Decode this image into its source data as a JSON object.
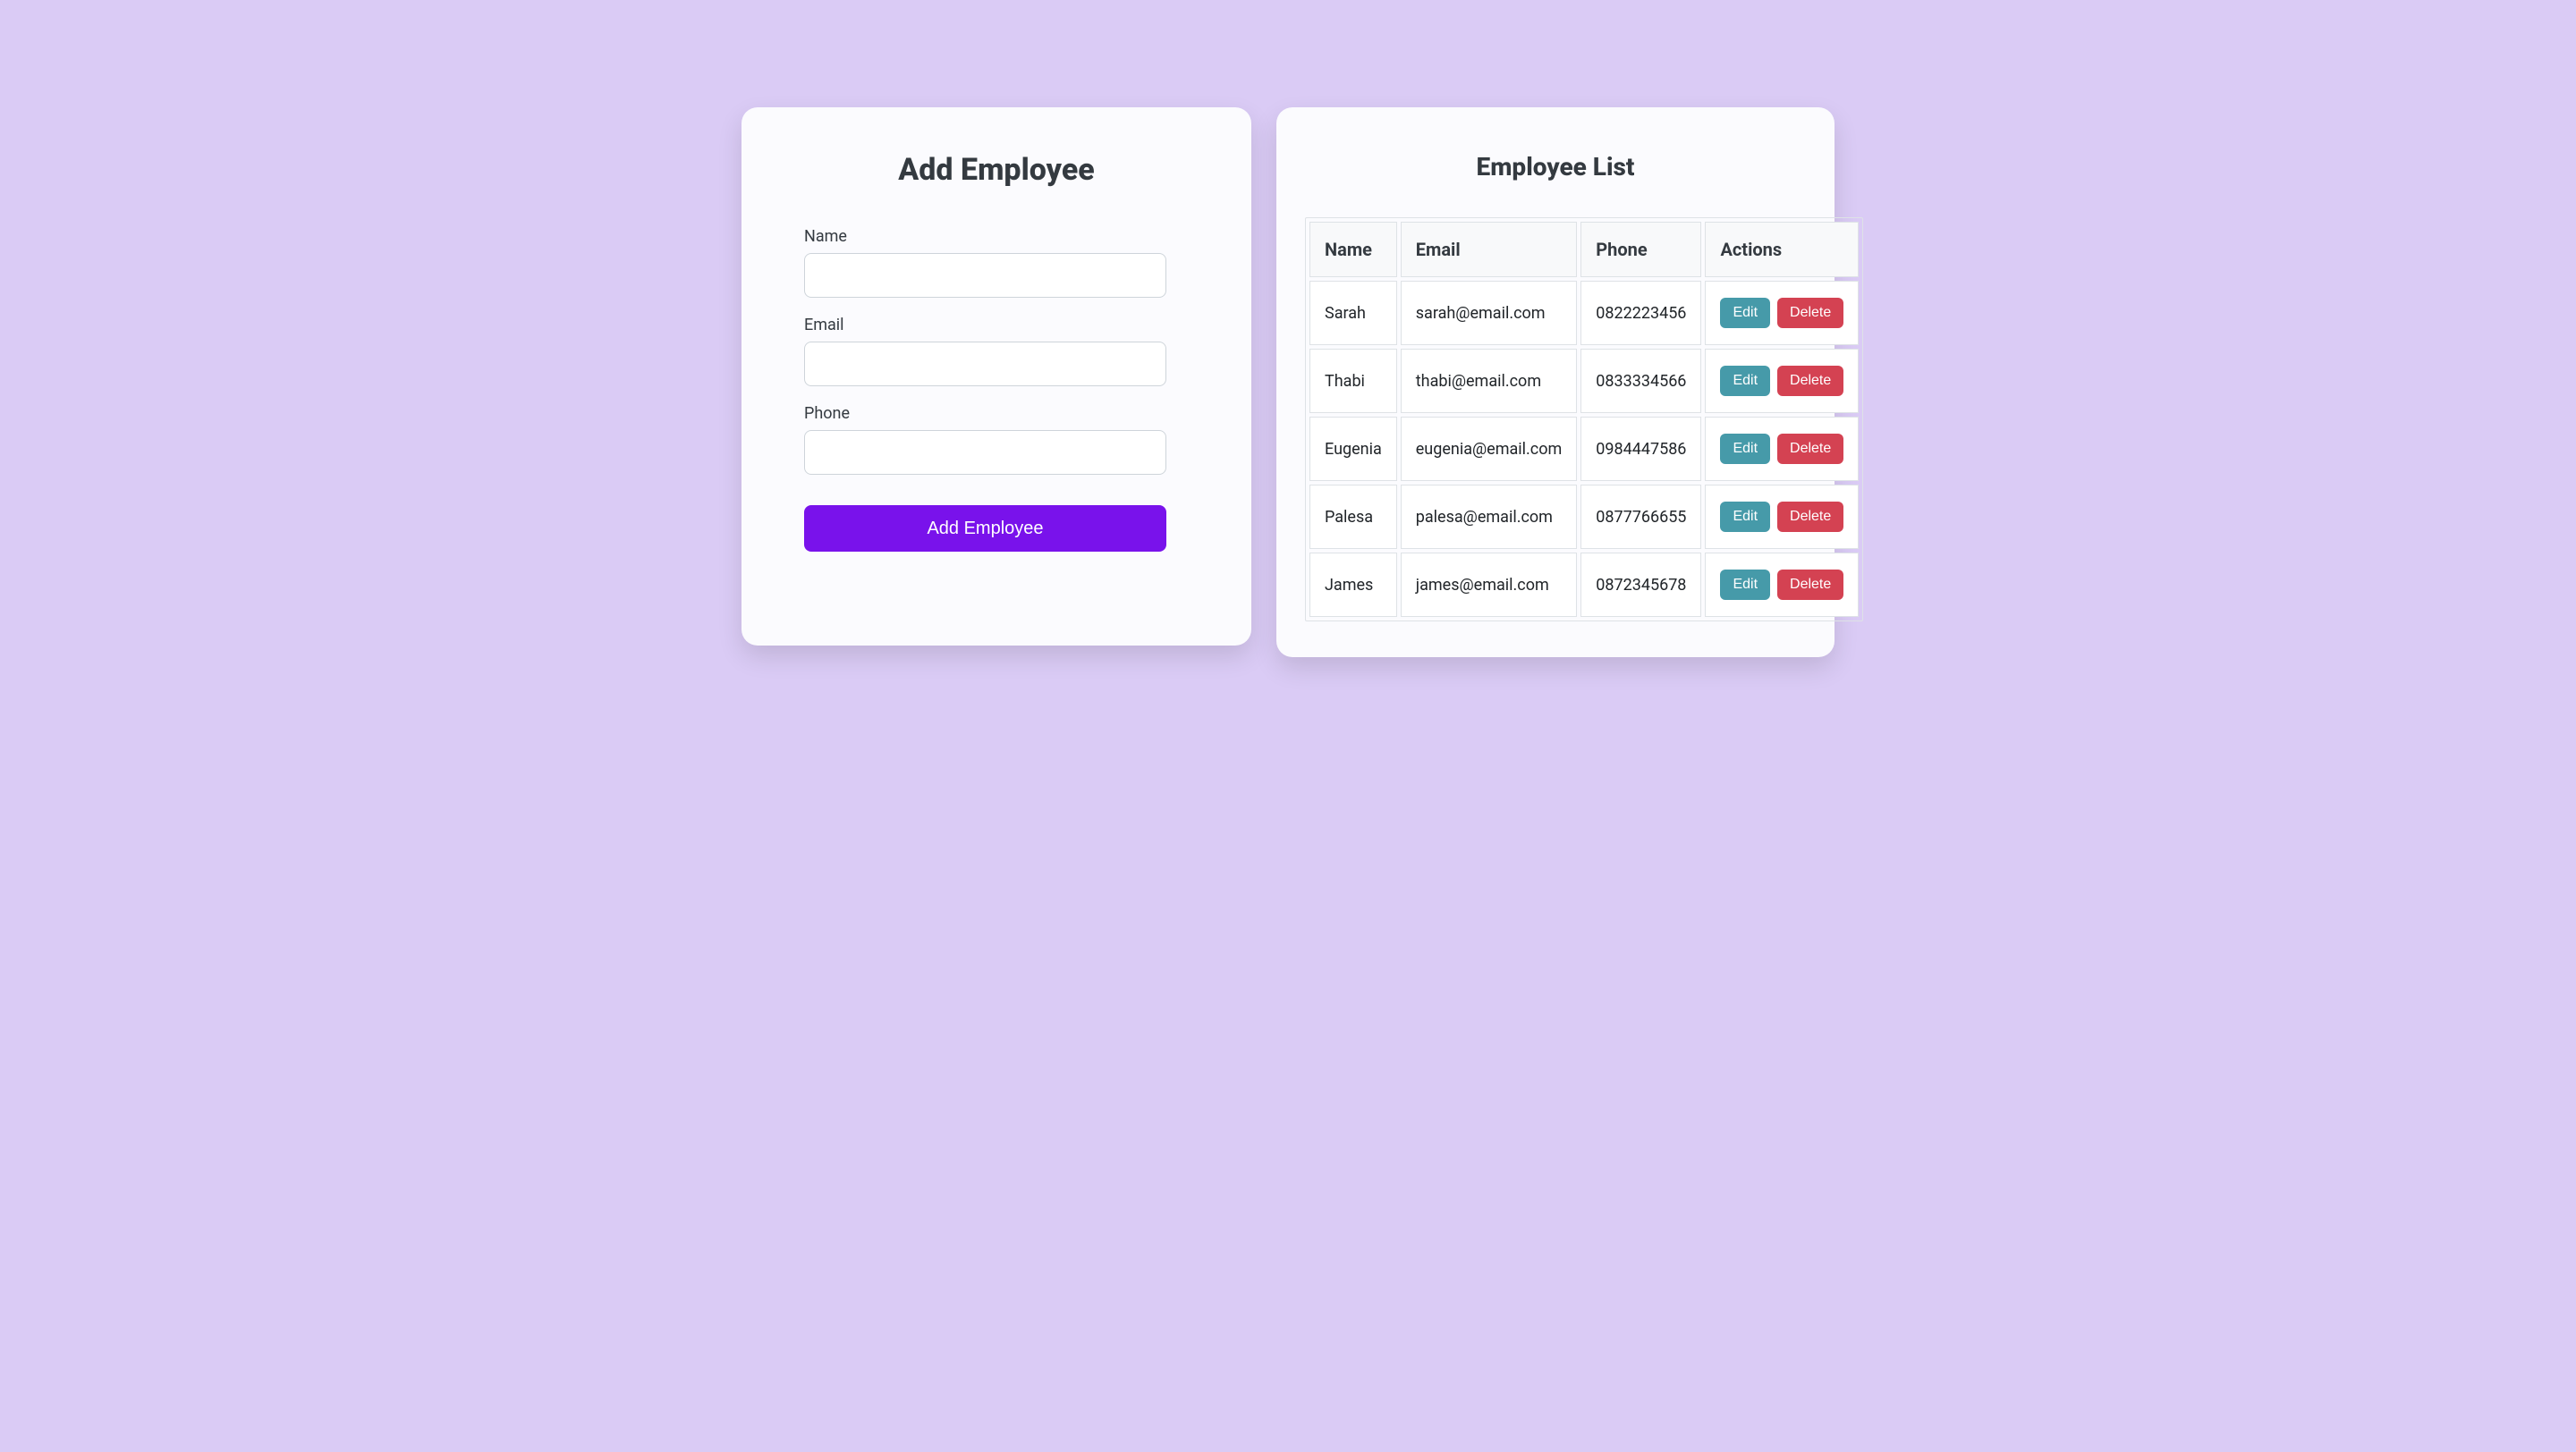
{
  "form": {
    "title": "Add Employee",
    "name_label": "Name",
    "email_label": "Email",
    "phone_label": "Phone",
    "name_value": "",
    "email_value": "",
    "phone_value": "",
    "submit_label": "Add Employee"
  },
  "list": {
    "title": "Employee List",
    "columns": {
      "name": "Name",
      "email": "Email",
      "phone": "Phone",
      "actions": "Actions"
    },
    "edit_label": "Edit",
    "delete_label": "Delete",
    "rows": [
      {
        "name": "Sarah",
        "email": "sarah@email.com",
        "phone": "0822223456"
      },
      {
        "name": "Thabi",
        "email": "thabi@email.com",
        "phone": "0833334566"
      },
      {
        "name": "Eugenia",
        "email": "eugenia@email.com",
        "phone": "0984447586"
      },
      {
        "name": "Palesa",
        "email": "palesa@email.com",
        "phone": "0877766655"
      },
      {
        "name": "James",
        "email": "james@email.com",
        "phone": "0872345678"
      }
    ]
  },
  "colors": {
    "page_bg": "#dacbf5",
    "card_bg": "#fbfbfe",
    "primary": "#7912eb",
    "edit": "#469aa9",
    "delete": "#d44252"
  }
}
